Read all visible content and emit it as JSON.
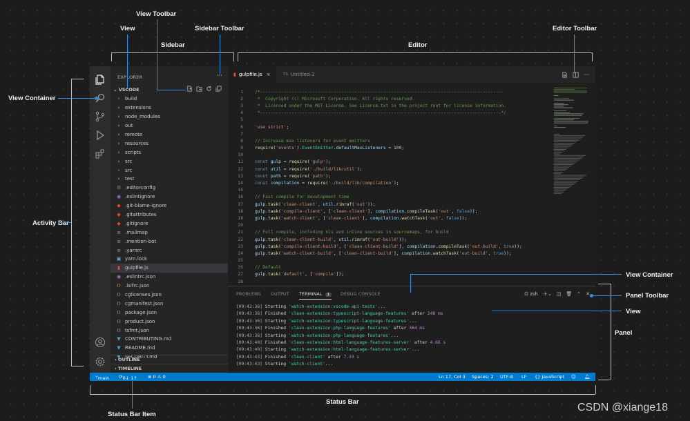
{
  "annotations": {
    "view_toolbar": "View Toolbar",
    "view": "View",
    "sidebar_toolbar": "Sidebar Toolbar",
    "sidebar": "Sidebar",
    "editor": "Editor",
    "editor_toolbar": "Editor Toolbar",
    "view_container": "View Container",
    "activity_bar": "Activity Bar",
    "panel_view_container": "View Container",
    "panel_toolbar": "Panel Toolbar",
    "panel_view": "View",
    "panel": "Panel",
    "status_bar": "Status Bar",
    "status_bar_item": "Status Bar Item"
  },
  "sidebar": {
    "title": "EXPLORER",
    "more": "···",
    "section": "VSCODE",
    "outline": "OUTLINE",
    "timeline": "TIMELINE",
    "items": [
      {
        "label": "build",
        "type": "folder"
      },
      {
        "label": "extensions",
        "type": "folder"
      },
      {
        "label": "node_modules",
        "type": "folder"
      },
      {
        "label": "out",
        "type": "folder"
      },
      {
        "label": "remote",
        "type": "folder"
      },
      {
        "label": "resources",
        "type": "folder"
      },
      {
        "label": "scripts",
        "type": "folder"
      },
      {
        "label": "src",
        "type": "folder"
      },
      {
        "label": "src",
        "type": "folder"
      },
      {
        "label": "test",
        "type": "folder"
      },
      {
        "label": ".editorconfig",
        "type": "gear"
      },
      {
        "label": ".eslintignore",
        "type": "eslint"
      },
      {
        "label": ".git-blame-ignore",
        "type": "git"
      },
      {
        "label": ".gitattributes",
        "type": "git"
      },
      {
        "label": ".gitignore",
        "type": "git"
      },
      {
        "label": ".mailmap",
        "type": "file"
      },
      {
        "label": ".mention-bot",
        "type": "file"
      },
      {
        "label": ".yarnrc",
        "type": "file"
      },
      {
        "label": "yarn.lock",
        "type": "lock"
      },
      {
        "label": "gulpfile.js",
        "type": "gulp",
        "selected": true
      },
      {
        "label": ".eslintrc.json",
        "type": "eslint"
      },
      {
        "label": ".lsifrc.json",
        "type": "json"
      },
      {
        "label": "cglicenses.json",
        "type": "json"
      },
      {
        "label": "cgmanifest.json",
        "type": "json"
      },
      {
        "label": "package.json",
        "type": "json"
      },
      {
        "label": "product.json",
        "type": "json"
      },
      {
        "label": "tsfmt.json",
        "type": "json"
      },
      {
        "label": "CONTRIBUTING.md",
        "type": "md"
      },
      {
        "label": "README.md",
        "type": "md"
      },
      {
        "label": "SECURITY.md",
        "type": "md"
      }
    ]
  },
  "editor": {
    "tabs": [
      {
        "label": "gulpfile.js",
        "close": "×"
      },
      {
        "label": "Untitled-2",
        "prefix": "TS"
      }
    ],
    "lines": [
      {
        "n": "1",
        "text": "/*---------------------------------------------------------------------------------------------"
      },
      {
        "n": "2",
        "text": " *  Copyright (c) Microsoft Corporation. All rights reserved."
      },
      {
        "n": "3",
        "text": " *  Licensed under the MIT License. See License.txt in the project root for license information."
      },
      {
        "n": "4",
        "text": " *--------------------------------------------------------------------------------------------*/"
      },
      {
        "n": "5",
        "text": ""
      },
      {
        "n": "6",
        "text": "'use strict';"
      },
      {
        "n": "7",
        "text": ""
      },
      {
        "n": "8",
        "text": "// Increase max listeners for event emitters"
      },
      {
        "n": "9",
        "text": "require('events').EventEmitter.defaultMaxListeners = 100;"
      },
      {
        "n": "10",
        "text": ""
      },
      {
        "n": "11",
        "text": "const gulp = require('gulp');"
      },
      {
        "n": "12",
        "text": "const util = require('./build/lib/util');"
      },
      {
        "n": "13",
        "text": "const path = require('path');"
      },
      {
        "n": "14",
        "text": "const compilation = require('./build/lib/compilation');"
      },
      {
        "n": "15",
        "text": ""
      },
      {
        "n": "16",
        "text": "// Fast compile for development time"
      },
      {
        "n": "17",
        "text": "gulp.task('clean-client', util.rimraf('out'));"
      },
      {
        "n": "18",
        "text": "gulp.task('compile-client', ['clean-client'], compilation.compileTask('out', false));"
      },
      {
        "n": "19",
        "text": "gulp.task('watch-client', ['clean-client'], compilation.watchTask('out', false));"
      },
      {
        "n": "20",
        "text": ""
      },
      {
        "n": "21",
        "text": "// Full compile, including nls and inline sources in sourcemaps, for build"
      },
      {
        "n": "22",
        "text": "gulp.task('clean-client-build', util.rimraf('out-build'));"
      },
      {
        "n": "23",
        "text": "gulp.task('compile-client-build', ['clean-client-build'], compilation.compileTask('out-build', true));"
      },
      {
        "n": "24",
        "text": "gulp.task('watch-client-build', ['clean-client-build'], compilation.watchTask('out-build', true));"
      },
      {
        "n": "25",
        "text": ""
      },
      {
        "n": "26",
        "text": "// Default"
      },
      {
        "n": "27",
        "text": "gulp.task('default', ['compile']);"
      },
      {
        "n": "28",
        "text": ""
      }
    ]
  },
  "panel": {
    "tabs": [
      "PROBLEMS",
      "OUTPUT",
      "TERMINAL",
      "DEBUG CONSOLE"
    ],
    "terminal_badge": "1",
    "shell": "zsh",
    "lines": [
      {
        "ts": "[09:43:36]",
        "verb": " Starting ",
        "name": "'watch-extension:vscode-api-tests'",
        "after": "...",
        "time": ""
      },
      {
        "ts": "[09:43:36]",
        "verb": " Finished ",
        "name": "'clean-extension:typescript-language-features'",
        "after": " after ",
        "time": "248 ms"
      },
      {
        "ts": "[09:43:36]",
        "verb": " Starting ",
        "name": "'watch-extension:typescript-language-features'",
        "after": "...",
        "time": ""
      },
      {
        "ts": "[09:43:36]",
        "verb": " Finished ",
        "name": "'clean-extension:php-language-features'",
        "after": " after ",
        "time": "384 ms"
      },
      {
        "ts": "[09:43:36]",
        "verb": " Starting ",
        "name": "'watch-extension:php-language-features'",
        "after": "...",
        "time": ""
      },
      {
        "ts": "[09:43:40]",
        "verb": " Finished ",
        "name": "'clean-extension:html-language-features-server'",
        "after": " after ",
        "time": "4.66 s"
      },
      {
        "ts": "[09:43:40]",
        "verb": " Starting ",
        "name": "'watch-extension:html-language-features-server'",
        "after": "...",
        "time": ""
      },
      {
        "ts": "[09:43:43]",
        "verb": " Finished ",
        "name": "'clean-client'",
        "after": " after ",
        "time": "7.33 s"
      },
      {
        "ts": "[09:43:43]",
        "verb": " Starting ",
        "name": "'watch-client'",
        "after": "...",
        "time": ""
      }
    ]
  },
  "statusbar": {
    "branch": "main",
    "sync": "0↓ 1↑",
    "problems": "⊗ 0 ⚠ 0",
    "position": "Ln 17, Col 3",
    "spaces": "Spaces: 2",
    "encoding": "UTF-8",
    "eol": "LF",
    "language": "{} JavaScript"
  },
  "watermark": "CSDN @xiange18",
  "colors": {
    "accent": "#2d8fe6",
    "status_bar": "#007acc"
  }
}
